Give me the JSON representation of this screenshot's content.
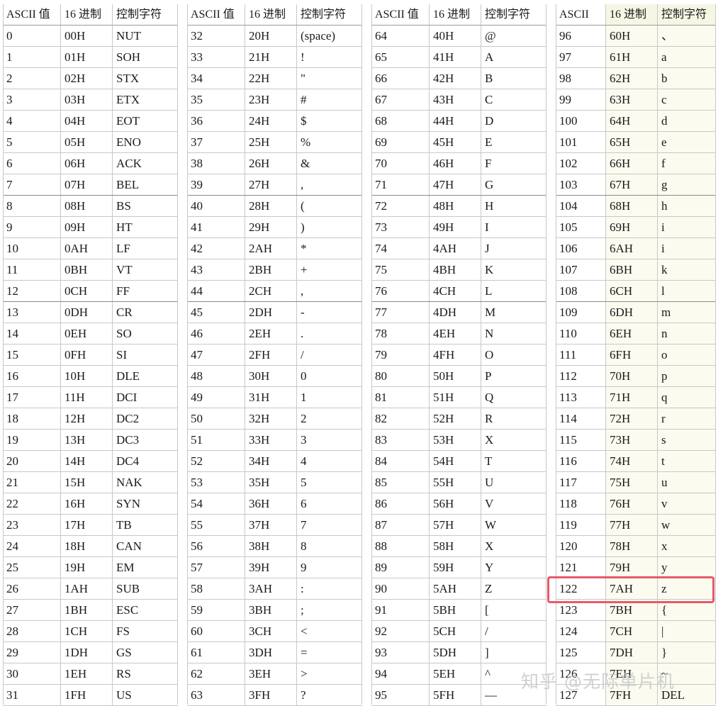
{
  "tables": [
    {
      "headers": [
        "ASCII 值",
        "16 进制",
        "控制字符"
      ],
      "rows": [
        [
          "0",
          "00H",
          "NUT"
        ],
        [
          "1",
          "01H",
          "SOH"
        ],
        [
          "2",
          "02H",
          "STX"
        ],
        [
          "3",
          "03H",
          "ETX"
        ],
        [
          "4",
          "04H",
          "EOT"
        ],
        [
          "5",
          "05H",
          "ENO"
        ],
        [
          "6",
          "06H",
          "ACK"
        ],
        [
          "7",
          "07H",
          "BEL"
        ],
        [
          "8",
          "08H",
          "BS"
        ],
        [
          "9",
          "09H",
          "HT"
        ],
        [
          "10",
          "0AH",
          "LF"
        ],
        [
          "11",
          "0BH",
          "VT"
        ],
        [
          "12",
          "0CH",
          "FF"
        ],
        [
          "13",
          "0DH",
          "CR"
        ],
        [
          "14",
          "0EH",
          "SO"
        ],
        [
          "15",
          "0FH",
          "SI"
        ],
        [
          "16",
          "10H",
          "DLE"
        ],
        [
          "17",
          "11H",
          "DCI"
        ],
        [
          "18",
          "12H",
          "DC2"
        ],
        [
          "19",
          "13H",
          "DC3"
        ],
        [
          "20",
          "14H",
          "DC4"
        ],
        [
          "21",
          "15H",
          "NAK"
        ],
        [
          "22",
          "16H",
          "SYN"
        ],
        [
          "23",
          "17H",
          "TB"
        ],
        [
          "24",
          "18H",
          "CAN"
        ],
        [
          "25",
          "19H",
          "EM"
        ],
        [
          "26",
          "1AH",
          "SUB"
        ],
        [
          "27",
          "1BH",
          "ESC"
        ],
        [
          "28",
          "1CH",
          "FS"
        ],
        [
          "29",
          "1DH",
          "GS"
        ],
        [
          "30",
          "1EH",
          "RS"
        ],
        [
          "31",
          "1FH",
          "US"
        ]
      ]
    },
    {
      "headers": [
        "ASCII 值",
        "16 进制",
        "控制字符"
      ],
      "rows": [
        [
          "32",
          "20H",
          "(space)"
        ],
        [
          "33",
          "21H",
          "!"
        ],
        [
          "34",
          "22H",
          "\""
        ],
        [
          "35",
          "23H",
          "#"
        ],
        [
          "36",
          "24H",
          "$"
        ],
        [
          "37",
          "25H",
          "%"
        ],
        [
          "38",
          "26H",
          "&"
        ],
        [
          "39",
          "27H",
          ","
        ],
        [
          "40",
          "28H",
          "("
        ],
        [
          "41",
          "29H",
          ")"
        ],
        [
          "42",
          "2AH",
          "*"
        ],
        [
          "43",
          "2BH",
          "+"
        ],
        [
          "44",
          "2CH",
          ","
        ],
        [
          "45",
          "2DH",
          "-"
        ],
        [
          "46",
          "2EH",
          "."
        ],
        [
          "47",
          "2FH",
          "/"
        ],
        [
          "48",
          "30H",
          "0"
        ],
        [
          "49",
          "31H",
          "1"
        ],
        [
          "50",
          "32H",
          "2"
        ],
        [
          "51",
          "33H",
          "3"
        ],
        [
          "52",
          "34H",
          "4"
        ],
        [
          "53",
          "35H",
          "5"
        ],
        [
          "54",
          "36H",
          "6"
        ],
        [
          "55",
          "37H",
          "7"
        ],
        [
          "56",
          "38H",
          "8"
        ],
        [
          "57",
          "39H",
          "9"
        ],
        [
          "58",
          "3AH",
          ":"
        ],
        [
          "59",
          "3BH",
          ";"
        ],
        [
          "60",
          "3CH",
          "<"
        ],
        [
          "61",
          "3DH",
          "="
        ],
        [
          "62",
          "3EH",
          ">"
        ],
        [
          "63",
          "3FH",
          "?"
        ]
      ]
    },
    {
      "headers": [
        "ASCII 值",
        "16 进制",
        "控制字符"
      ],
      "rows": [
        [
          "64",
          "40H",
          "@"
        ],
        [
          "65",
          "41H",
          "A"
        ],
        [
          "66",
          "42H",
          "B"
        ],
        [
          "67",
          "43H",
          "C"
        ],
        [
          "68",
          "44H",
          "D"
        ],
        [
          "69",
          "45H",
          "E"
        ],
        [
          "70",
          "46H",
          "F"
        ],
        [
          "71",
          "47H",
          "G"
        ],
        [
          "72",
          "48H",
          "H"
        ],
        [
          "73",
          "49H",
          "I"
        ],
        [
          "74",
          "4AH",
          "J"
        ],
        [
          "75",
          "4BH",
          "K"
        ],
        [
          "76",
          "4CH",
          "L"
        ],
        [
          "77",
          "4DH",
          "M"
        ],
        [
          "78",
          "4EH",
          "N"
        ],
        [
          "79",
          "4FH",
          "O"
        ],
        [
          "80",
          "50H",
          "P"
        ],
        [
          "81",
          "51H",
          "Q"
        ],
        [
          "82",
          "52H",
          "R"
        ],
        [
          "83",
          "53H",
          "X"
        ],
        [
          "84",
          "54H",
          "T"
        ],
        [
          "85",
          "55H",
          "U"
        ],
        [
          "86",
          "56H",
          "V"
        ],
        [
          "87",
          "57H",
          "W"
        ],
        [
          "88",
          "58H",
          "X"
        ],
        [
          "89",
          "59H",
          "Y"
        ],
        [
          "90",
          "5AH",
          "Z"
        ],
        [
          "91",
          "5BH",
          "["
        ],
        [
          "92",
          "5CH",
          "/"
        ],
        [
          "93",
          "5DH",
          "]"
        ],
        [
          "94",
          "5EH",
          "^"
        ],
        [
          "95",
          "5FH",
          "—"
        ]
      ]
    },
    {
      "headers": [
        "ASCII",
        "16 进制",
        "控制字符"
      ],
      "rows": [
        [
          "96",
          "60H",
          "、"
        ],
        [
          "97",
          "61H",
          "a"
        ],
        [
          "98",
          "62H",
          "b"
        ],
        [
          "99",
          "63H",
          "c"
        ],
        [
          "100",
          "64H",
          "d"
        ],
        [
          "101",
          "65H",
          "e"
        ],
        [
          "102",
          "66H",
          "f"
        ],
        [
          "103",
          "67H",
          "g"
        ],
        [
          "104",
          "68H",
          "h"
        ],
        [
          "105",
          "69H",
          "i"
        ],
        [
          "106",
          "6AH",
          "i"
        ],
        [
          "107",
          "6BH",
          "k"
        ],
        [
          "108",
          "6CH",
          "l"
        ],
        [
          "109",
          "6DH",
          "m"
        ],
        [
          "110",
          "6EH",
          "n"
        ],
        [
          "111",
          "6FH",
          "o"
        ],
        [
          "112",
          "70H",
          "p"
        ],
        [
          "113",
          "71H",
          "q"
        ],
        [
          "114",
          "72H",
          "r"
        ],
        [
          "115",
          "73H",
          "s"
        ],
        [
          "116",
          "74H",
          "t"
        ],
        [
          "117",
          "75H",
          "u"
        ],
        [
          "118",
          "76H",
          "v"
        ],
        [
          "119",
          "77H",
          "w"
        ],
        [
          "120",
          "78H",
          "x"
        ],
        [
          "121",
          "79H",
          "y"
        ],
        [
          "122",
          "7AH",
          "z"
        ],
        [
          "123",
          "7BH",
          "{"
        ],
        [
          "124",
          "7CH",
          "|"
        ],
        [
          "125",
          "7DH",
          "}"
        ],
        [
          "126",
          "7EH",
          "~"
        ],
        [
          "127",
          "7FH",
          "DEL"
        ]
      ]
    }
  ],
  "highlight": {
    "table": 4,
    "ascii": "122",
    "color": "#e65a6a"
  },
  "watermark": "知乎 @无际单片机",
  "colors": {
    "grid": "#c8c8c8",
    "shade": "#fbfbf0"
  }
}
